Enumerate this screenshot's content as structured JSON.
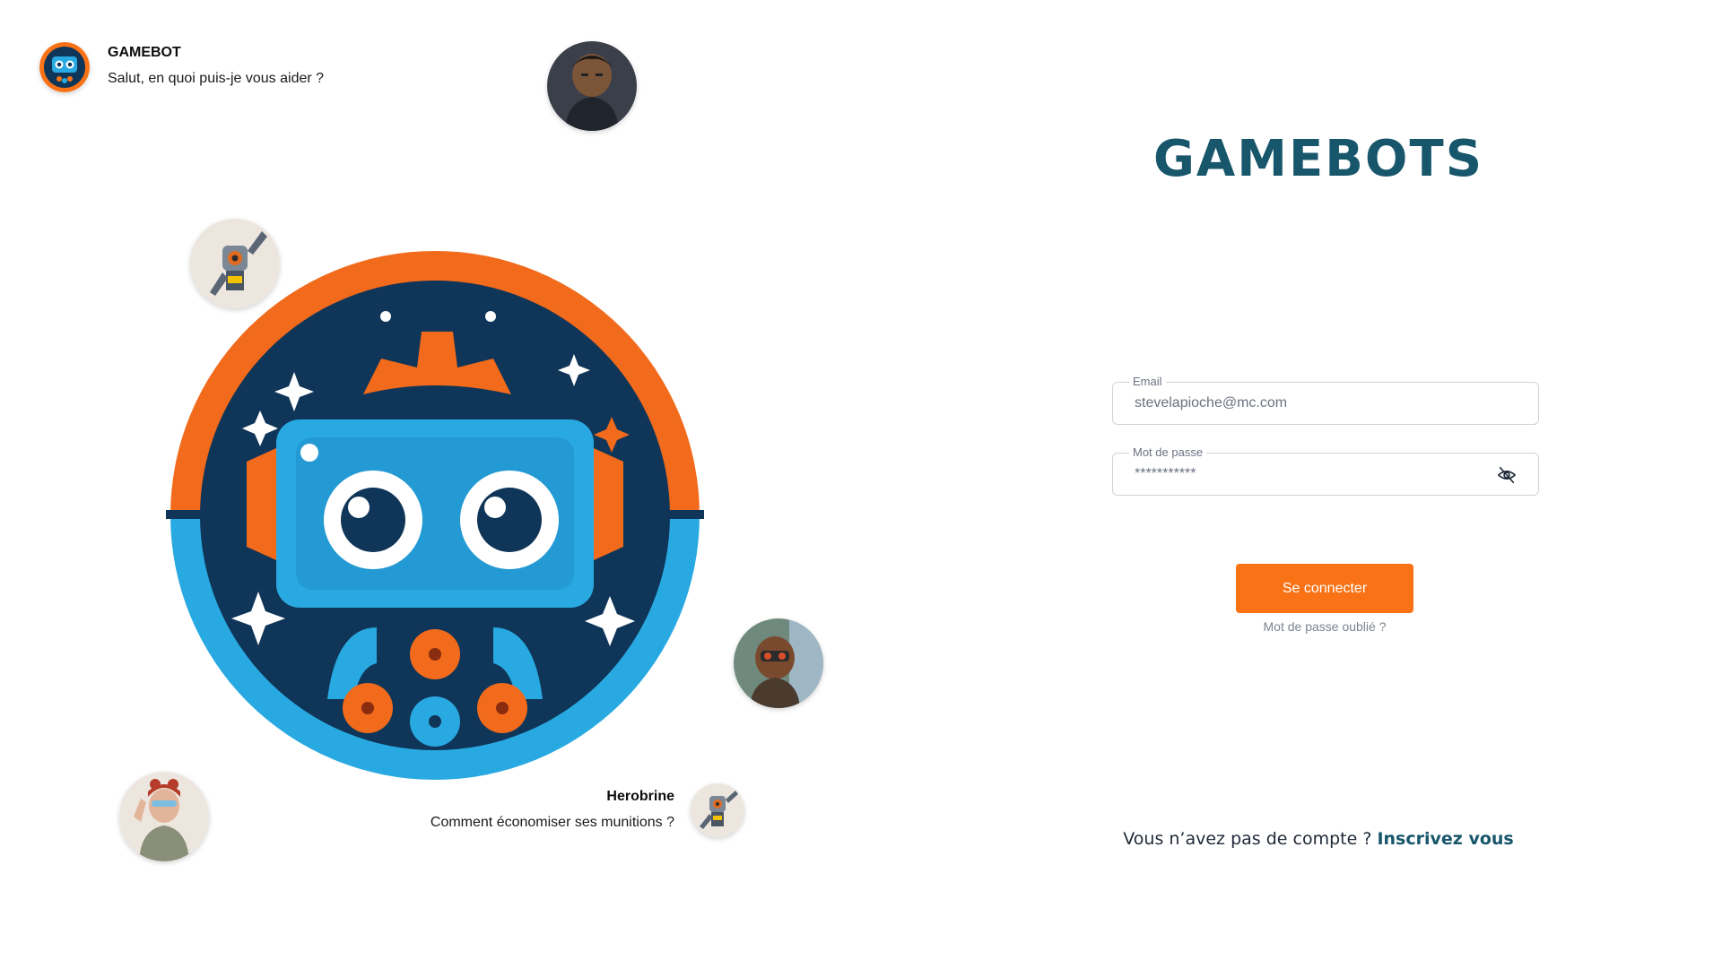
{
  "chat_top": {
    "name": "GAMEBOT",
    "message": "Salut, en quoi puis-je vous aider ?"
  },
  "chat_bottom": {
    "name": "Herobrine",
    "message": "Comment économiser ses munitions ?"
  },
  "brand": {
    "title": "GAMEBOTS"
  },
  "login": {
    "email_label": "Email",
    "email_value": "stevelapioche@mc.com",
    "password_label": "Mot de passe",
    "password_value": "***********",
    "submit_label": "Se connecter",
    "forgot_label": "Mot de passe oublié ?"
  },
  "signup": {
    "prompt": "Vous n’avez pas de compte ?",
    "link": "Inscrivez vous"
  },
  "colors": {
    "brand": "#17566b",
    "accent": "#f97316",
    "navy": "#0f3558",
    "sky": "#29a9e1"
  },
  "icons": [
    "robot-logo-icon",
    "eye-off-icon",
    "avatar-icon"
  ]
}
